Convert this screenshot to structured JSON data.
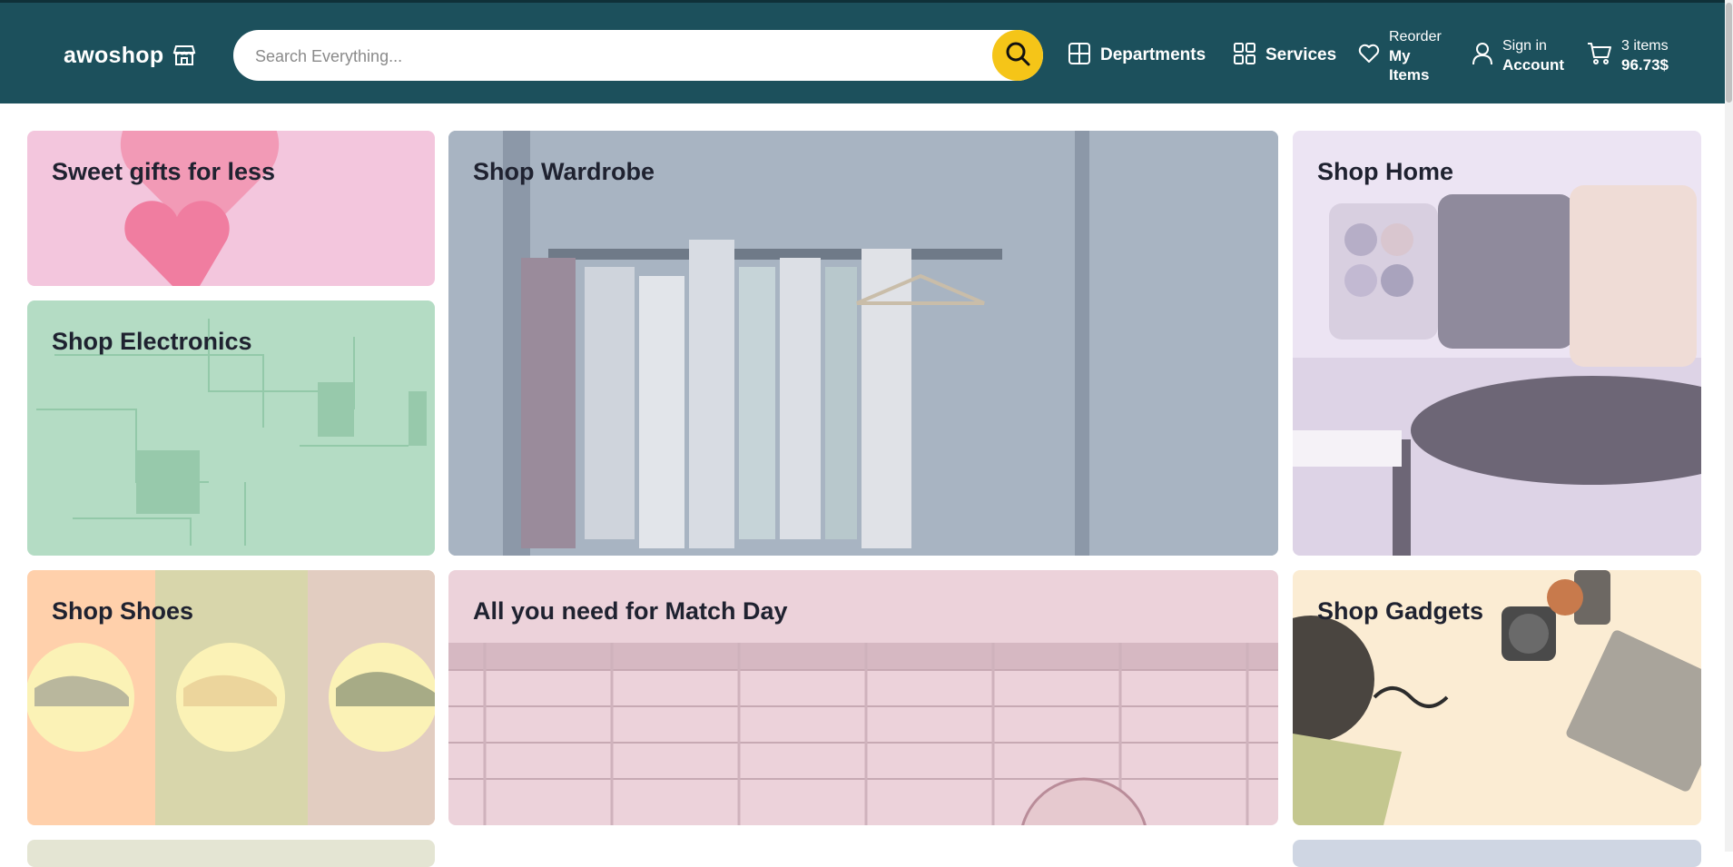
{
  "header": {
    "logo_text": "awoshop",
    "search_placeholder": "Search Everything...",
    "departments_label": "Departments",
    "services_label": "Services",
    "reorder_small": "Reorder",
    "reorder_line1": "My",
    "reorder_line2": "Items",
    "signin_small": "Sign in",
    "signin_big": "Account",
    "cart_count": "3 items",
    "cart_total": "96.73$"
  },
  "tiles": {
    "gifts": "Sweet gifts for less",
    "wardrobe": "Shop Wardrobe",
    "home": "Shop Home",
    "electronics": "Shop Electronics",
    "shoes": "Shop Shoes",
    "matchday": "All you need for Match Day",
    "gadgets": "Shop Gadgets"
  },
  "colors": {
    "header_bg": "#1c505c",
    "search_button": "#f5c518",
    "gifts_bg": "#f3c6dd",
    "wardrobe_bg": "#b3bfcc",
    "home_bg": "#ece4f3",
    "electronics_bg": "#b4dcc4",
    "matchday_bg": "#ecd2da",
    "gadgets_bg": "#fbecd3"
  }
}
